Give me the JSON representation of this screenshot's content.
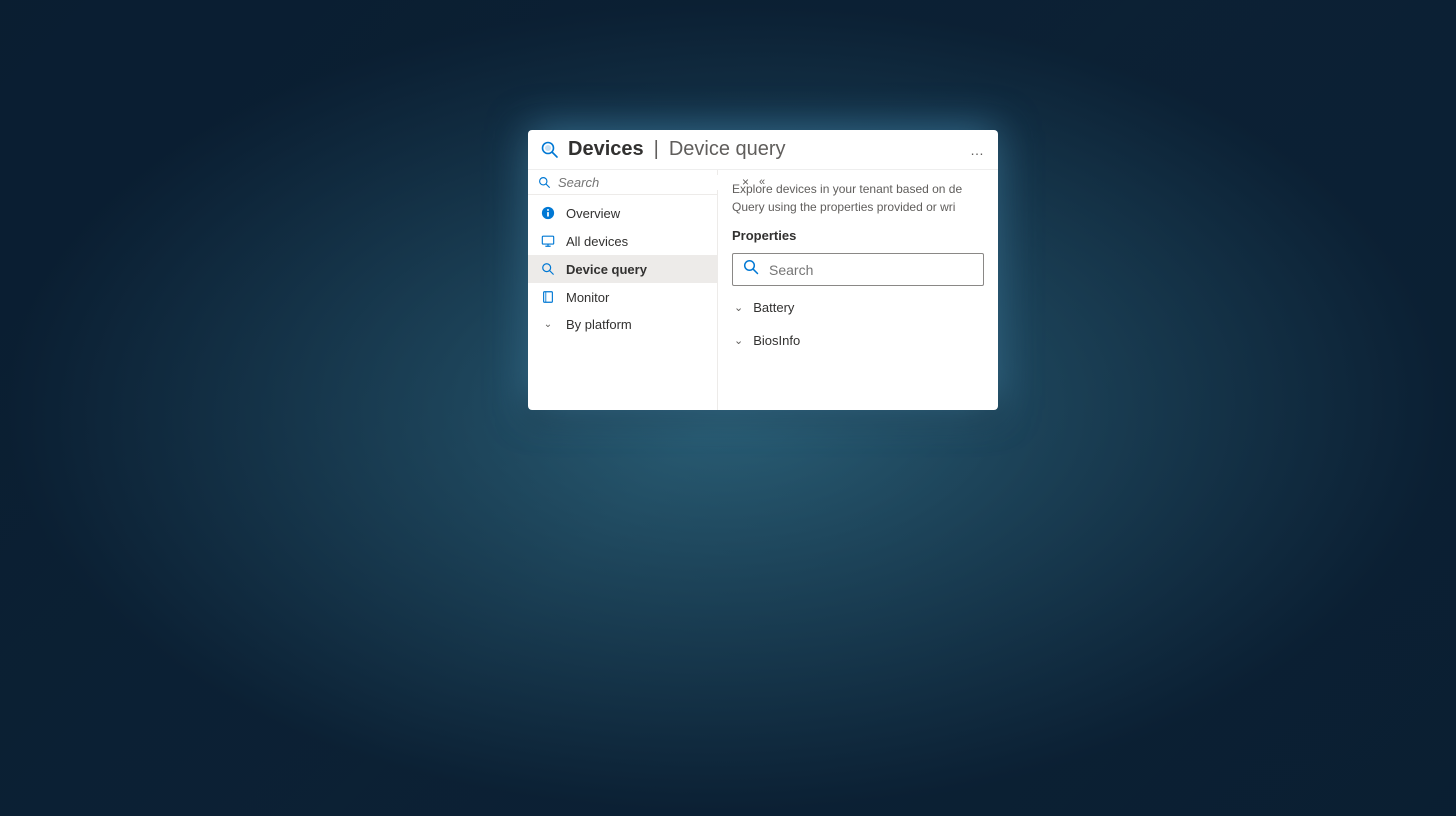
{
  "header": {
    "title": "Devices",
    "separator": "|",
    "subtitle": "Device query",
    "ellipsis": "…"
  },
  "sidebar": {
    "search_placeholder": "Search",
    "items": [
      {
        "id": "overview",
        "label": "Overview",
        "icon": "info"
      },
      {
        "id": "all-devices",
        "label": "All devices",
        "icon": "monitor"
      },
      {
        "id": "device-query",
        "label": "Device query",
        "icon": "search",
        "active": true
      },
      {
        "id": "monitor",
        "label": "Monitor",
        "icon": "book"
      },
      {
        "id": "by-platform",
        "label": "By platform",
        "icon": "chevron",
        "expandable": true
      }
    ]
  },
  "content": {
    "intro_line1": "Explore devices in your tenant based on de",
    "intro_line2": "Query using the properties provided or wri",
    "properties_heading": "Properties",
    "properties_search_placeholder": "Search",
    "groups": [
      {
        "id": "battery",
        "label": "Battery"
      },
      {
        "id": "biosinfo",
        "label": "BiosInfo"
      }
    ]
  },
  "colors": {
    "accent": "#0078d4",
    "link": "#006f8f",
    "text": "#323130",
    "muted": "#605e5c"
  }
}
